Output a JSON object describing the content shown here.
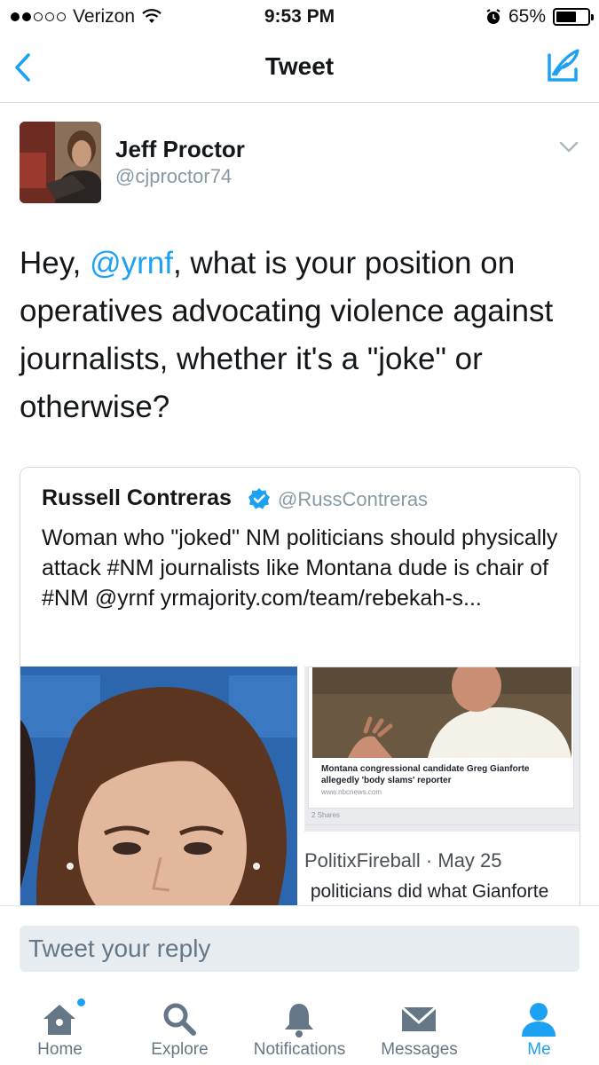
{
  "status_bar": {
    "carrier": "Verizon",
    "time": "9:53 PM",
    "battery": "65%",
    "battery_level": 0.65,
    "icons": [
      "signal-dots",
      "wifi-icon",
      "alarm-icon",
      "battery-icon"
    ]
  },
  "nav": {
    "title": "Tweet",
    "icons": [
      "back-chevron-icon",
      "compose-tweet-icon"
    ],
    "accent": "#1da1f2"
  },
  "tweet": {
    "author_name": "Jeff Proctor",
    "author_handle": "@cjproctor74",
    "text_before": "Hey, ",
    "mention": "@yrnf",
    "text_after": ", what is your position on operatives advocating violence against journalists, whether it's a \"joke\" or otherwise?"
  },
  "quoted_tweet": {
    "author_name": "Russell Contreras",
    "author_handle": "@RussContreras",
    "verified": true,
    "text": "Woman who \"joked\" NM politicians should physically attack #NM journalists like Montana dude is chair of #NM @yrnf yrmajority.com/team/rebekah-s...",
    "screenshot": {
      "headline": "Montana congressional candidate Greg Gianforte allegedly 'body slams' reporter",
      "source": "www.nbcnews.com",
      "shares": "2 Shares",
      "post_author": "PolitixFireball · May 25",
      "post_text": ") politicians did what Gianforte"
    }
  },
  "reply": {
    "placeholder": "Tweet your reply"
  },
  "tabs": [
    {
      "label": "Home",
      "icon": "home-icon",
      "active": false,
      "badge": true
    },
    {
      "label": "Explore",
      "icon": "search-icon",
      "active": false
    },
    {
      "label": "Notifications",
      "icon": "bell-icon",
      "active": false
    },
    {
      "label": "Messages",
      "icon": "envelope-icon",
      "active": false
    },
    {
      "label": "Me",
      "icon": "person-icon",
      "active": true
    }
  ],
  "colors": {
    "accent": "#1da1f2",
    "secondary_text": "#8899a6",
    "tab_inactive": "#657786"
  }
}
